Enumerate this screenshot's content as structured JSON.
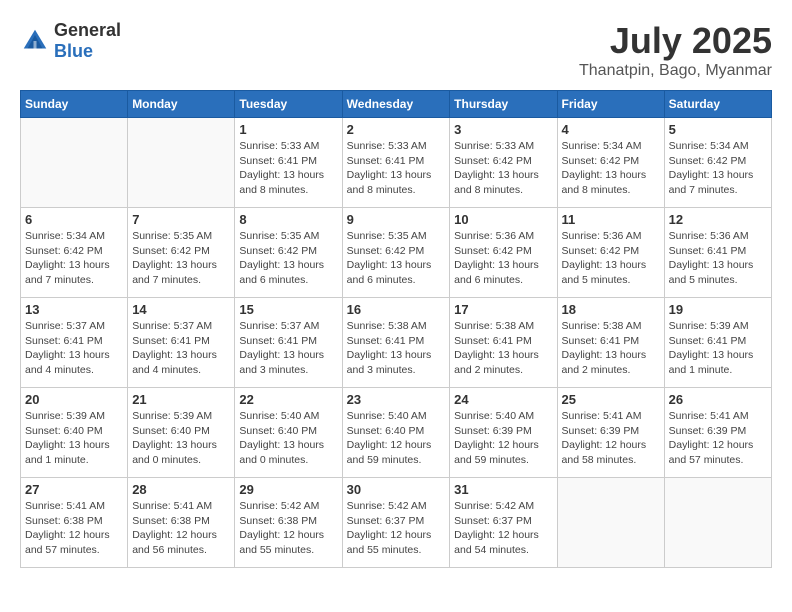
{
  "logo": {
    "general": "General",
    "blue": "Blue"
  },
  "header": {
    "month": "July 2025",
    "location": "Thanatpin, Bago, Myanmar"
  },
  "weekdays": [
    "Sunday",
    "Monday",
    "Tuesday",
    "Wednesday",
    "Thursday",
    "Friday",
    "Saturday"
  ],
  "weeks": [
    [
      {
        "day": "",
        "info": ""
      },
      {
        "day": "",
        "info": ""
      },
      {
        "day": "1",
        "info": "Sunrise: 5:33 AM\nSunset: 6:41 PM\nDaylight: 13 hours and 8 minutes."
      },
      {
        "day": "2",
        "info": "Sunrise: 5:33 AM\nSunset: 6:41 PM\nDaylight: 13 hours and 8 minutes."
      },
      {
        "day": "3",
        "info": "Sunrise: 5:33 AM\nSunset: 6:42 PM\nDaylight: 13 hours and 8 minutes."
      },
      {
        "day": "4",
        "info": "Sunrise: 5:34 AM\nSunset: 6:42 PM\nDaylight: 13 hours and 8 minutes."
      },
      {
        "day": "5",
        "info": "Sunrise: 5:34 AM\nSunset: 6:42 PM\nDaylight: 13 hours and 7 minutes."
      }
    ],
    [
      {
        "day": "6",
        "info": "Sunrise: 5:34 AM\nSunset: 6:42 PM\nDaylight: 13 hours and 7 minutes."
      },
      {
        "day": "7",
        "info": "Sunrise: 5:35 AM\nSunset: 6:42 PM\nDaylight: 13 hours and 7 minutes."
      },
      {
        "day": "8",
        "info": "Sunrise: 5:35 AM\nSunset: 6:42 PM\nDaylight: 13 hours and 6 minutes."
      },
      {
        "day": "9",
        "info": "Sunrise: 5:35 AM\nSunset: 6:42 PM\nDaylight: 13 hours and 6 minutes."
      },
      {
        "day": "10",
        "info": "Sunrise: 5:36 AM\nSunset: 6:42 PM\nDaylight: 13 hours and 6 minutes."
      },
      {
        "day": "11",
        "info": "Sunrise: 5:36 AM\nSunset: 6:42 PM\nDaylight: 13 hours and 5 minutes."
      },
      {
        "day": "12",
        "info": "Sunrise: 5:36 AM\nSunset: 6:41 PM\nDaylight: 13 hours and 5 minutes."
      }
    ],
    [
      {
        "day": "13",
        "info": "Sunrise: 5:37 AM\nSunset: 6:41 PM\nDaylight: 13 hours and 4 minutes."
      },
      {
        "day": "14",
        "info": "Sunrise: 5:37 AM\nSunset: 6:41 PM\nDaylight: 13 hours and 4 minutes."
      },
      {
        "day": "15",
        "info": "Sunrise: 5:37 AM\nSunset: 6:41 PM\nDaylight: 13 hours and 3 minutes."
      },
      {
        "day": "16",
        "info": "Sunrise: 5:38 AM\nSunset: 6:41 PM\nDaylight: 13 hours and 3 minutes."
      },
      {
        "day": "17",
        "info": "Sunrise: 5:38 AM\nSunset: 6:41 PM\nDaylight: 13 hours and 2 minutes."
      },
      {
        "day": "18",
        "info": "Sunrise: 5:38 AM\nSunset: 6:41 PM\nDaylight: 13 hours and 2 minutes."
      },
      {
        "day": "19",
        "info": "Sunrise: 5:39 AM\nSunset: 6:41 PM\nDaylight: 13 hours and 1 minute."
      }
    ],
    [
      {
        "day": "20",
        "info": "Sunrise: 5:39 AM\nSunset: 6:40 PM\nDaylight: 13 hours and 1 minute."
      },
      {
        "day": "21",
        "info": "Sunrise: 5:39 AM\nSunset: 6:40 PM\nDaylight: 13 hours and 0 minutes."
      },
      {
        "day": "22",
        "info": "Sunrise: 5:40 AM\nSunset: 6:40 PM\nDaylight: 13 hours and 0 minutes."
      },
      {
        "day": "23",
        "info": "Sunrise: 5:40 AM\nSunset: 6:40 PM\nDaylight: 12 hours and 59 minutes."
      },
      {
        "day": "24",
        "info": "Sunrise: 5:40 AM\nSunset: 6:39 PM\nDaylight: 12 hours and 59 minutes."
      },
      {
        "day": "25",
        "info": "Sunrise: 5:41 AM\nSunset: 6:39 PM\nDaylight: 12 hours and 58 minutes."
      },
      {
        "day": "26",
        "info": "Sunrise: 5:41 AM\nSunset: 6:39 PM\nDaylight: 12 hours and 57 minutes."
      }
    ],
    [
      {
        "day": "27",
        "info": "Sunrise: 5:41 AM\nSunset: 6:38 PM\nDaylight: 12 hours and 57 minutes."
      },
      {
        "day": "28",
        "info": "Sunrise: 5:41 AM\nSunset: 6:38 PM\nDaylight: 12 hours and 56 minutes."
      },
      {
        "day": "29",
        "info": "Sunrise: 5:42 AM\nSunset: 6:38 PM\nDaylight: 12 hours and 55 minutes."
      },
      {
        "day": "30",
        "info": "Sunrise: 5:42 AM\nSunset: 6:37 PM\nDaylight: 12 hours and 55 minutes."
      },
      {
        "day": "31",
        "info": "Sunrise: 5:42 AM\nSunset: 6:37 PM\nDaylight: 12 hours and 54 minutes."
      },
      {
        "day": "",
        "info": ""
      },
      {
        "day": "",
        "info": ""
      }
    ]
  ]
}
